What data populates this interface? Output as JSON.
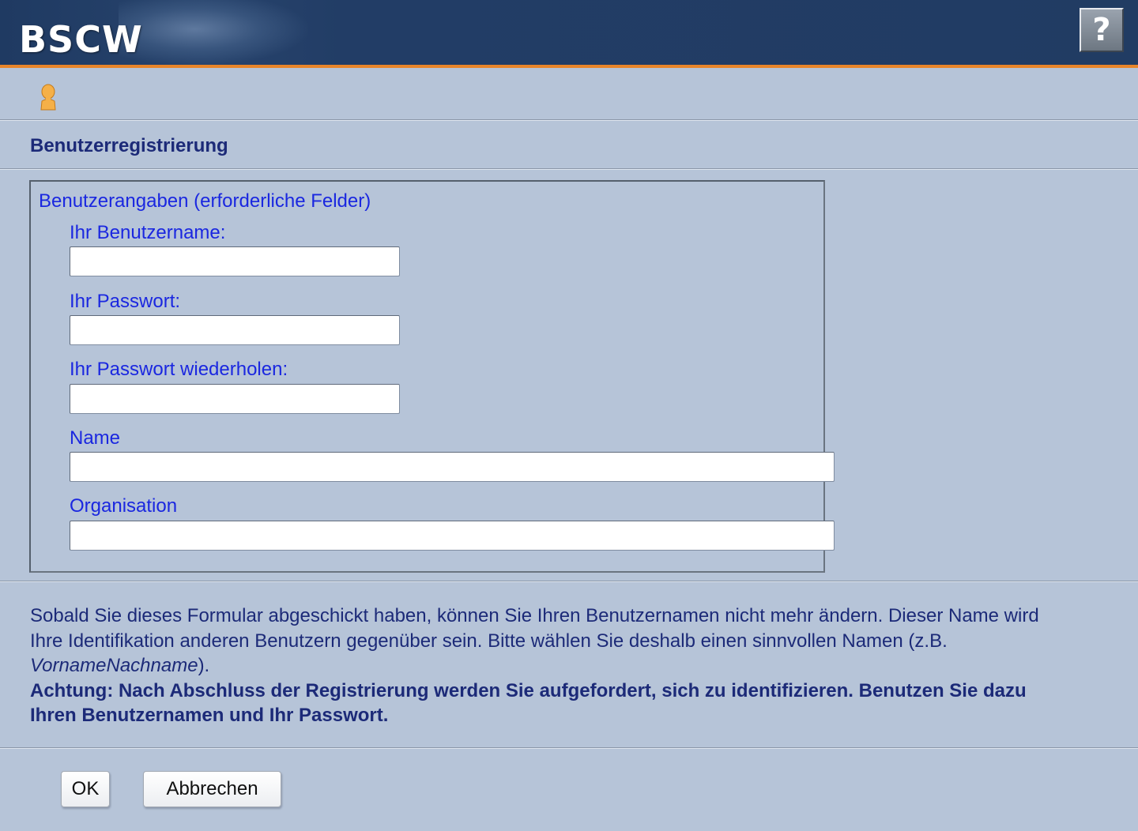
{
  "header": {
    "logo_text": "BSCW",
    "help_label": "?"
  },
  "page": {
    "title": "Benutzerregistrierung"
  },
  "form": {
    "legend": "Benutzerangaben (erforderliche Felder)",
    "fields": [
      {
        "label": "Ihr Benutzername:",
        "value": "",
        "type": "text"
      },
      {
        "label": "Ihr Passwort:",
        "value": "",
        "type": "password"
      },
      {
        "label": "Ihr Passwort wiederholen:",
        "value": "",
        "type": "password"
      },
      {
        "label": "Name",
        "value": "",
        "type": "text"
      },
      {
        "label": "Organisation",
        "value": "",
        "type": "text"
      }
    ]
  },
  "info": {
    "text_before": "Sobald Sie dieses Formular abgeschickt haben, können Sie Ihren Benutzernamen nicht mehr ändern. Dieser Name wird Ihre Identifikation anderen Benutzern gegenüber sein. Bitte wählen Sie deshalb einen sinnvollen Namen (z.B. ",
    "example": "VornameNachname",
    "text_after": ").",
    "warning": "Achtung: Nach Abschluss der Registrierung werden Sie aufgefordert, sich zu identifizieren. Benutzen Sie dazu Ihren Benutzernamen und Ihr Passwort."
  },
  "buttons": {
    "ok_label": "OK",
    "cancel_label": "Abbrechen"
  },
  "colors": {
    "header_bg": "#213c63",
    "accent_orange": "#e8852a",
    "page_bg": "#b6c4d8",
    "label_blue": "#1a27e0",
    "text_navy": "#1c2a78"
  },
  "icons": {
    "user": "user-icon",
    "help": "question-mark-icon"
  }
}
